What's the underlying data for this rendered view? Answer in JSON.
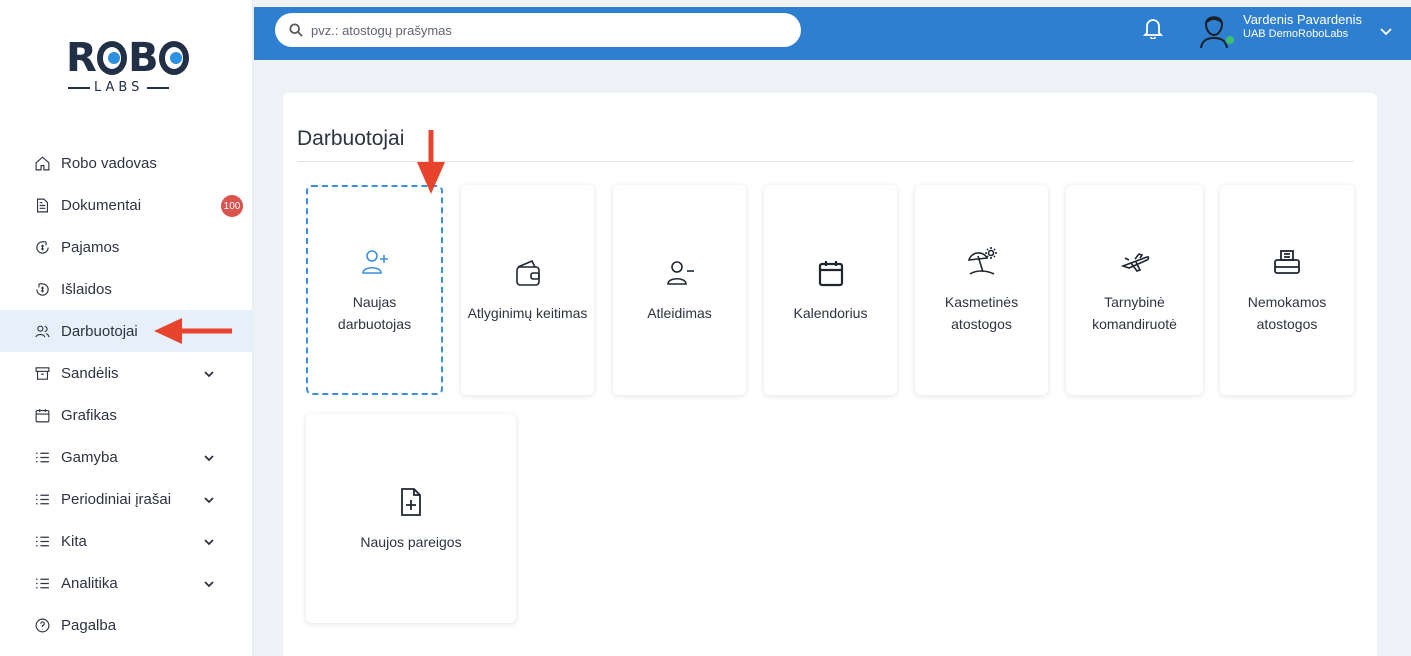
{
  "brand": {
    "logo_word_left": "R",
    "logo_word_mid": "B",
    "logo_sub": "LABS"
  },
  "search": {
    "placeholder": "pvz.: atostogų prašymas"
  },
  "user": {
    "name": "Vardenis Pavardenis",
    "company": "UAB DemoRoboLabs"
  },
  "sidebar": {
    "items": [
      {
        "label": "Robo vadovas",
        "icon": "home-icon"
      },
      {
        "label": "Dokumentai",
        "icon": "document-icon",
        "badge": "100"
      },
      {
        "label": "Pajamos",
        "icon": "income-icon"
      },
      {
        "label": "Išlaidos",
        "icon": "expenses-icon"
      },
      {
        "label": "Darbuotojai",
        "icon": "users-icon",
        "active": true
      },
      {
        "label": "Sandėlis",
        "icon": "warehouse-icon",
        "expandable": true
      },
      {
        "label": "Grafikas",
        "icon": "calendar-icon"
      },
      {
        "label": "Gamyba",
        "icon": "list-icon",
        "expandable": true
      },
      {
        "label": "Periodiniai įrašai",
        "icon": "list-icon",
        "expandable": true
      },
      {
        "label": "Kita",
        "icon": "list-icon",
        "expandable": true
      },
      {
        "label": "Analitika",
        "icon": "list-icon",
        "expandable": true
      },
      {
        "label": "Pagalba",
        "icon": "help-icon"
      }
    ]
  },
  "main": {
    "title": "Darbuotojai",
    "tiles": [
      {
        "label": "Naujas darbuotojas",
        "icon": "user-plus-icon"
      },
      {
        "label": "Atlyginimų keitimas",
        "icon": "wallet-icon"
      },
      {
        "label": "Atleidimas",
        "icon": "user-minus-icon"
      },
      {
        "label": "Kalendorius",
        "icon": "calendar-icon"
      },
      {
        "label": "Kasmetinės atostogos",
        "icon": "beach-umbrella-icon"
      },
      {
        "label": "Tarnybinė komandiruotė",
        "icon": "airplane-icon"
      },
      {
        "label": "Nemokamos atostogos",
        "icon": "cash-register-icon"
      },
      {
        "label": "Naujos pareigos",
        "icon": "file-plus-icon"
      }
    ]
  },
  "colors": {
    "topbar": "#2f7fd0",
    "accent": "#3d8fe0",
    "badge": "#d9534f",
    "arrow": "#e8432d",
    "active_bg": "#e6f0fb"
  }
}
